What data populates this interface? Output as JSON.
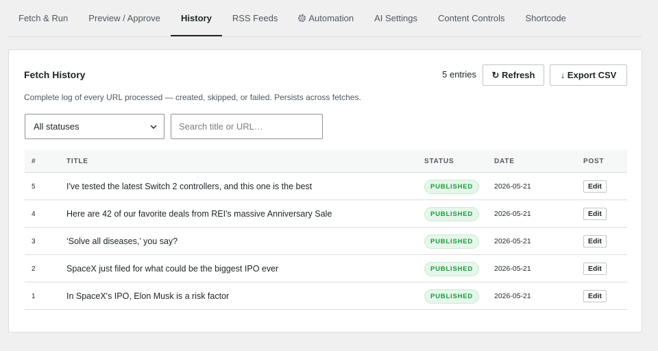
{
  "tabs": [
    {
      "label": "Fetch & Run",
      "active": false
    },
    {
      "label": "Preview / Approve",
      "active": false
    },
    {
      "label": "History",
      "active": true
    },
    {
      "label": "RSS Feeds",
      "active": false
    },
    {
      "label": "Automation",
      "active": false,
      "icon": "gear-icon"
    },
    {
      "label": "AI Settings",
      "active": false
    },
    {
      "label": "Content Controls",
      "active": false
    },
    {
      "label": "Shortcode",
      "active": false
    }
  ],
  "panel": {
    "title": "Fetch History",
    "entries": "5 entries",
    "refresh_label": "↻ Refresh",
    "export_label": "↓ Export CSV",
    "description": "Complete log of every URL processed — created, skipped, or failed. Persists across fetches.",
    "status_filter": "All statuses",
    "search_placeholder": "Search title or URL…"
  },
  "table": {
    "headers": {
      "num": "#",
      "title": "TITLE",
      "status": "STATUS",
      "date": "DATE",
      "post": "POST"
    },
    "rows": [
      {
        "num": "5",
        "title": "I've tested the latest Switch 2 controllers, and this one is the best",
        "status": "PUBLISHED",
        "date": "2026-05-21",
        "post": "Edit"
      },
      {
        "num": "4",
        "title": "Here are 42 of our favorite deals from REI's massive Anniversary Sale",
        "status": "PUBLISHED",
        "date": "2026-05-21",
        "post": "Edit"
      },
      {
        "num": "3",
        "title": "‘Solve all diseases,’ you say?",
        "status": "PUBLISHED",
        "date": "2026-05-21",
        "post": "Edit"
      },
      {
        "num": "2",
        "title": "SpaceX just filed for what could be the biggest IPO ever",
        "status": "PUBLISHED",
        "date": "2026-05-21",
        "post": "Edit"
      },
      {
        "num": "1",
        "title": "In SpaceX's IPO, Elon Musk is a risk factor",
        "status": "PUBLISHED",
        "date": "2026-05-21",
        "post": "Edit"
      }
    ]
  },
  "colors": {
    "published_text": "#1a9a3c",
    "published_bg": "#e6f6ea",
    "active_tab_underline": "#1d2327"
  }
}
